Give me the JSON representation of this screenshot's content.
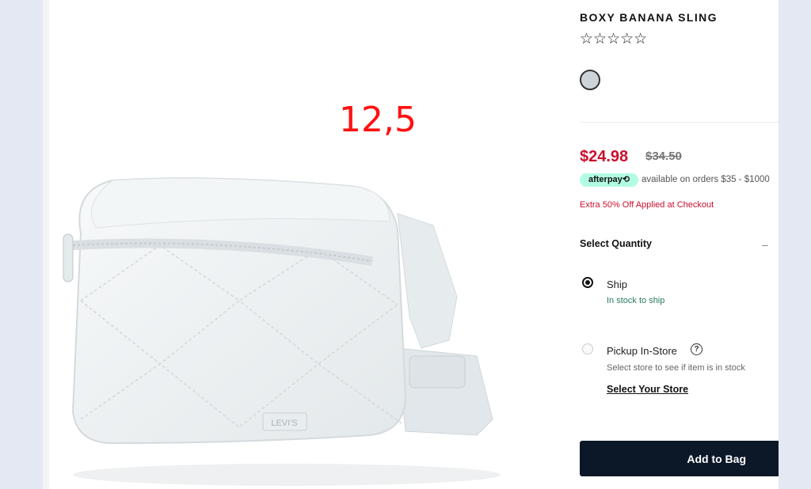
{
  "overlay_number": "12,5",
  "product": {
    "title": "BOXY BANANA SLING",
    "rating_stars": "☆☆☆☆☆",
    "swatch_color": "#cdd3d6",
    "price": "$24.98",
    "original_price": "$34.50",
    "afterpay_badge": "afterpay⟲",
    "afterpay_text": "available on orders $35 - $1000",
    "promo": "Extra 50% Off Applied at Checkout",
    "brand_mark": "LEVI'S"
  },
  "quantity": {
    "label": "Select Quantity",
    "toggle": "–"
  },
  "fulfillment": {
    "ship_label": "Ship",
    "ship_status": "In stock to ship",
    "pickup_label": "Pickup In-Store",
    "pickup_help": "?",
    "pickup_note": "Select store to see if item is in stock",
    "store_link": "Select Your Store"
  },
  "actions": {
    "add_to_bag": "Add to Bag"
  },
  "colors": {
    "price_red": "#c8102e",
    "button_navy": "#0c1728",
    "afterpay_mint": "#b2fce4",
    "in_stock_green": "#2a7a5c"
  }
}
